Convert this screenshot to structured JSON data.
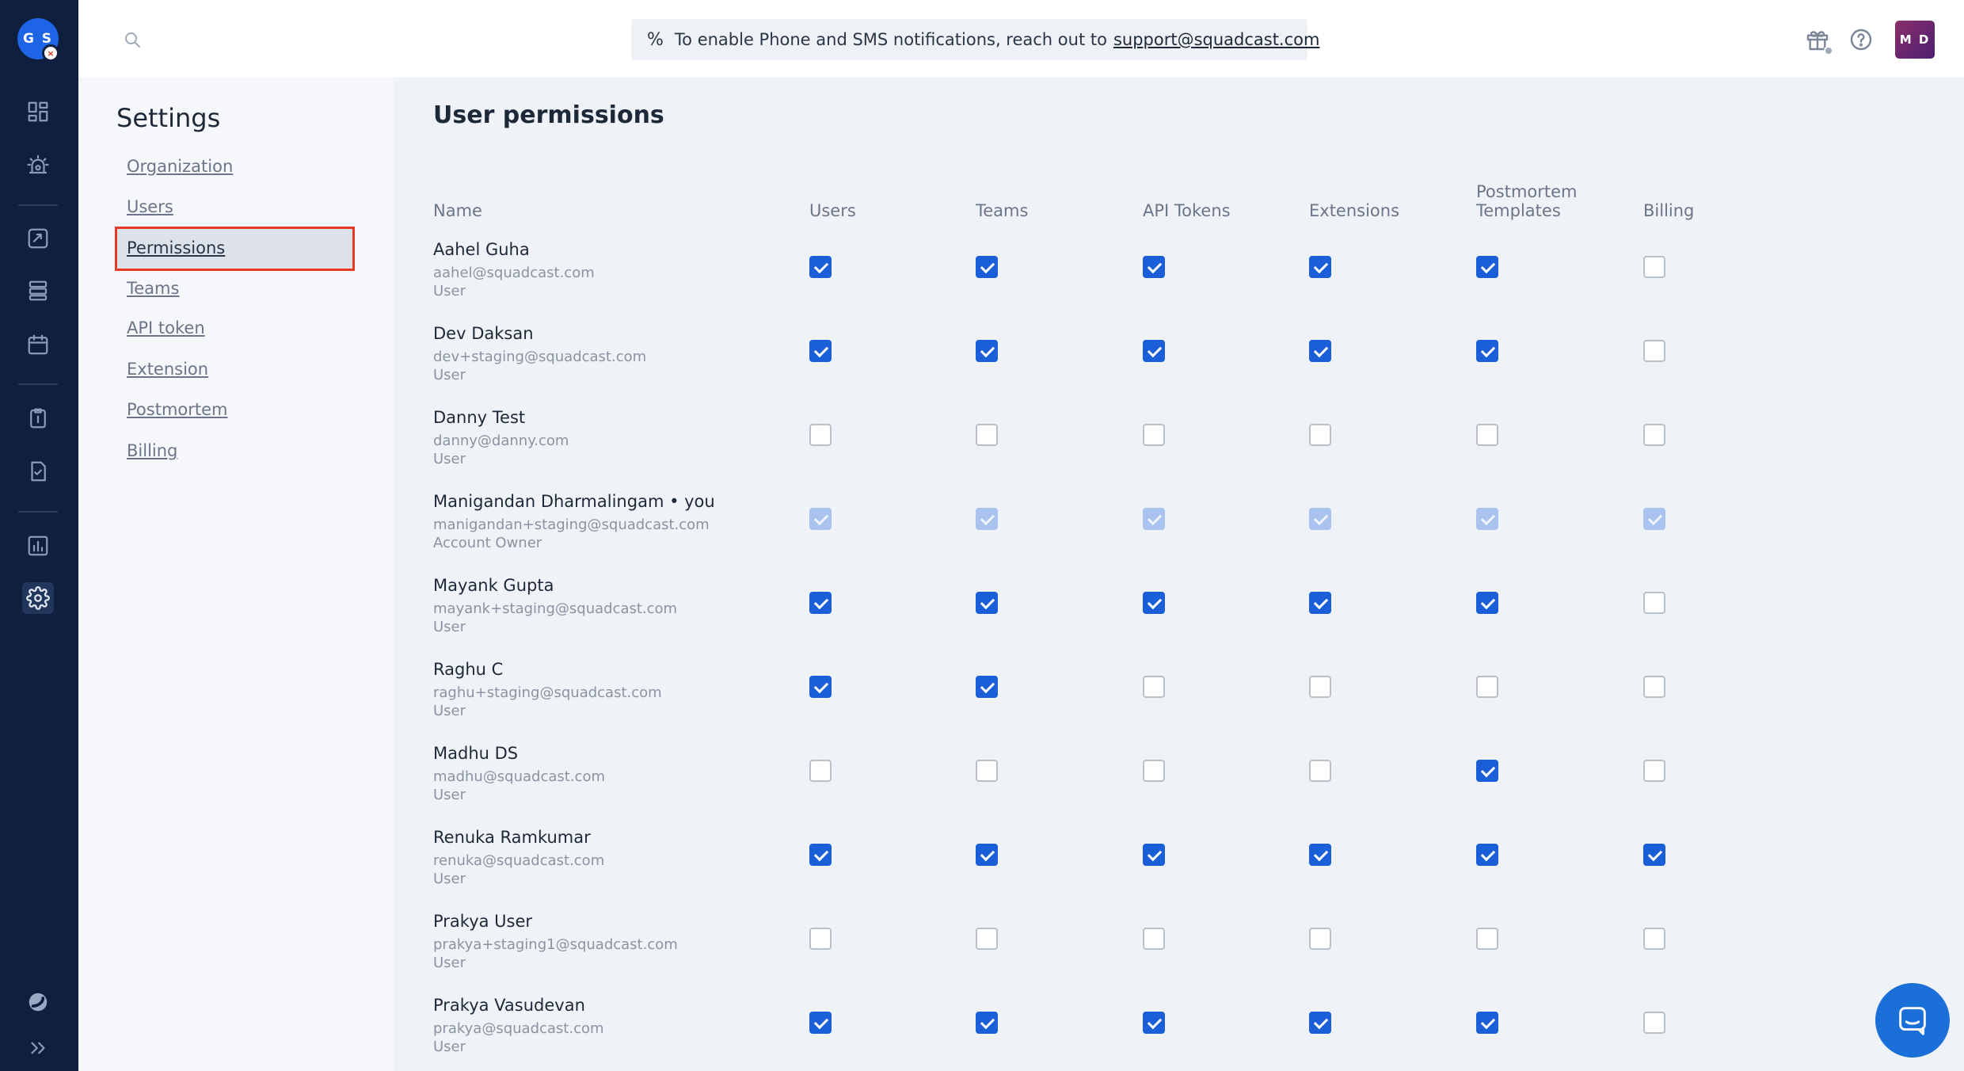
{
  "rail": {
    "org_initials": "G S",
    "org_badge": "×"
  },
  "header": {
    "banner_text": "To enable Phone and SMS notifications, reach out to",
    "banner_link": "support@squadcast.com",
    "user_initials": "M D"
  },
  "settings": {
    "title": "Settings",
    "nav": [
      {
        "label": "Organization"
      },
      {
        "label": "Users"
      },
      {
        "label": "Permissions"
      },
      {
        "label": "Teams"
      },
      {
        "label": "API token"
      },
      {
        "label": "Extension"
      },
      {
        "label": "Postmortem"
      },
      {
        "label": "Billing"
      }
    ],
    "active_item": "Permissions"
  },
  "main": {
    "title": "User permissions",
    "columns": {
      "name": "Name",
      "users": "Users",
      "teams": "Teams",
      "api_tokens": "API Tokens",
      "extensions": "Extensions",
      "postmortem_1": "Postmortem",
      "postmortem_2": "Templates",
      "billing": "Billing"
    },
    "rows": [
      {
        "name": "Aahel Guha",
        "email": "aahel@squadcast.com",
        "role": "User",
        "perms": [
          true,
          true,
          true,
          true,
          true,
          false
        ],
        "disabled": false
      },
      {
        "name": "Dev Daksan",
        "email": "dev+staging@squadcast.com",
        "role": "User",
        "perms": [
          true,
          true,
          true,
          true,
          true,
          false
        ],
        "disabled": false
      },
      {
        "name": "Danny Test",
        "email": "danny@danny.com",
        "role": "User",
        "perms": [
          false,
          false,
          false,
          false,
          false,
          false
        ],
        "disabled": false
      },
      {
        "name": "Manigandan Dharmalingam • you",
        "email": "manigandan+staging@squadcast.com",
        "role": "Account Owner",
        "perms": [
          true,
          true,
          true,
          true,
          true,
          true
        ],
        "disabled": true
      },
      {
        "name": "Mayank Gupta",
        "email": "mayank+staging@squadcast.com",
        "role": "User",
        "perms": [
          true,
          true,
          true,
          true,
          true,
          false
        ],
        "disabled": false
      },
      {
        "name": "Raghu C",
        "email": "raghu+staging@squadcast.com",
        "role": "User",
        "perms": [
          true,
          true,
          false,
          false,
          false,
          false
        ],
        "disabled": false
      },
      {
        "name": "Madhu DS",
        "email": "madhu@squadcast.com",
        "role": "User",
        "perms": [
          false,
          false,
          false,
          false,
          true,
          false
        ],
        "disabled": false
      },
      {
        "name": "Renuka Ramkumar",
        "email": "renuka@squadcast.com",
        "role": "User",
        "perms": [
          true,
          true,
          true,
          true,
          true,
          true
        ],
        "disabled": false
      },
      {
        "name": "Prakya User",
        "email": "prakya+staging1@squadcast.com",
        "role": "User",
        "perms": [
          false,
          false,
          false,
          false,
          false,
          false
        ],
        "disabled": false
      },
      {
        "name": "Prakya Vasudevan",
        "email": "prakya@squadcast.com",
        "role": "User",
        "perms": [
          true,
          true,
          true,
          true,
          true,
          false
        ],
        "disabled": false
      }
    ]
  },
  "colors": {
    "rail_bg": "#0f1f3d",
    "accent": "#1a5fd8",
    "highlight_border": "#e53a24"
  }
}
